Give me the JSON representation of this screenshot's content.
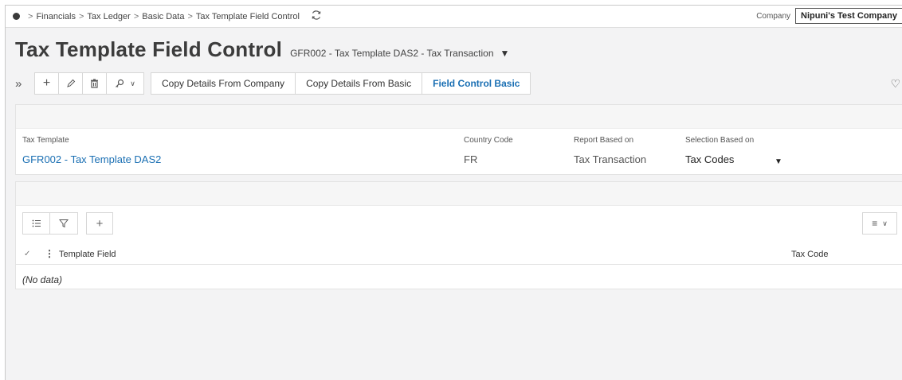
{
  "breadcrumb": {
    "items": [
      "Financials",
      "Tax Ledger",
      "Basic Data",
      "Tax Template Field Control"
    ],
    "separator": ">"
  },
  "company": {
    "label": "Company",
    "value": "Nipuni's Test Company"
  },
  "header": {
    "title": "Tax Template Field Control",
    "subtitle": "GFR002 - Tax Template DAS2 - Tax Transaction"
  },
  "toolbar": {
    "commands": [
      "Copy Details From Company",
      "Copy Details From Basic",
      "Field Control Basic"
    ],
    "active_command": "Field Control Basic"
  },
  "record": {
    "tax_template_label": "Tax Template",
    "tax_template_value": "GFR002 - Tax Template DAS2",
    "country_code_label": "Country Code",
    "country_code_value": "FR",
    "report_based_on_label": "Report Based on",
    "report_based_on_value": "Tax Transaction",
    "selection_based_on_label": "Selection Based on",
    "selection_based_on_value": "Tax Codes"
  },
  "grid": {
    "columns": [
      "Template Field",
      "Tax Code"
    ],
    "empty_text": "(No data)"
  },
  "colors": {
    "accent": "#1a6fb3",
    "background": "#f3f3f4"
  },
  "icons": {
    "expand": "double-chevron-right-icon",
    "add": "plus-icon",
    "edit": "pencil-icon",
    "delete": "trash-icon",
    "assign": "key-icon",
    "refresh": "refresh-icon",
    "favorite": "heart-icon"
  }
}
